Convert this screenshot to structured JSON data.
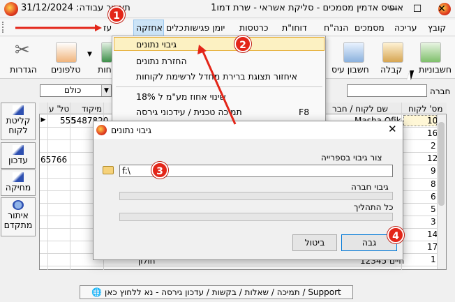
{
  "window": {
    "title": "אופיס אדמין מסמכים - סליקת אשראי - שרת דמו1",
    "date_label": "תאריך עבודה: 31/12/2024",
    "min": "—",
    "max": "☐",
    "close": "✕"
  },
  "menubar": {
    "items": [
      "קובץ",
      "עריכה",
      "מסמכים",
      "הנה\"ח",
      "דוחו\"ת",
      "כרטסות",
      "יומן פגישות",
      "כלים",
      "אחזקה",
      "עז"
    ]
  },
  "toolbar": {
    "items": [
      "חשבוניות",
      "קבלה",
      "חשבון עיס",
      "חות",
      "טלפונים",
      "הגדרות"
    ]
  },
  "filter": {
    "combo_value": "כולם",
    "company_label": "חברה"
  },
  "side_buttons": [
    "קליטת לקוח",
    "עדכון",
    "מחיקה",
    "איתור מתקדם"
  ],
  "grid": {
    "headers": [
      "מס' לקוח",
      "שם לקוח / חבר",
      "מיקוד",
      "טל' ע"
    ],
    "customer_numbers": [
      "10",
      "16",
      "2",
      "12",
      "9",
      "8",
      "6",
      "5",
      "3",
      "14",
      "17",
      "1"
    ],
    "row1_name": "Masha Ofik",
    "row1_zip": "5487820",
    "row1_phone": "555",
    "row4_phone": "65766",
    "row12_name": "חיים 12345",
    "row12_city": "חולון"
  },
  "dropdown": {
    "items": [
      {
        "label": "גיבוי נתונים",
        "shortcut": ""
      },
      {
        "label": "החזרת נתונים",
        "shortcut": ""
      },
      {
        "label": "איחזור תצוגת ברירת מחדל לרשימת לקוחות",
        "shortcut": ""
      },
      {
        "label": "שינוי אחוז מע\"מ ל 18%",
        "shortcut": ""
      },
      {
        "label": "תמיכה טכנית / עידכוני גירסה",
        "shortcut": "F8"
      }
    ]
  },
  "dialog": {
    "title": "גיבוי נתונים",
    "folder_label": "צור גיבוי בספרייה",
    "path_value": "f:\\",
    "company_backup_label": "גיבוי חברה",
    "total_progress_label": "כל התהליך",
    "ok_label": "גבה",
    "cancel_label": "ביטול",
    "progress_company": 0,
    "progress_total": 0
  },
  "annotations": [
    "1",
    "2",
    "3",
    "4"
  ],
  "statusbar": {
    "support_text": "Support / תמיכה / שאלות / בקשות / עדכון גירסה - נא ללחוץ כאן"
  },
  "colors": {
    "annotation_red": "#e32619",
    "menu_highlight": "#fcf1c2",
    "menu_open": "#cce4f7"
  }
}
